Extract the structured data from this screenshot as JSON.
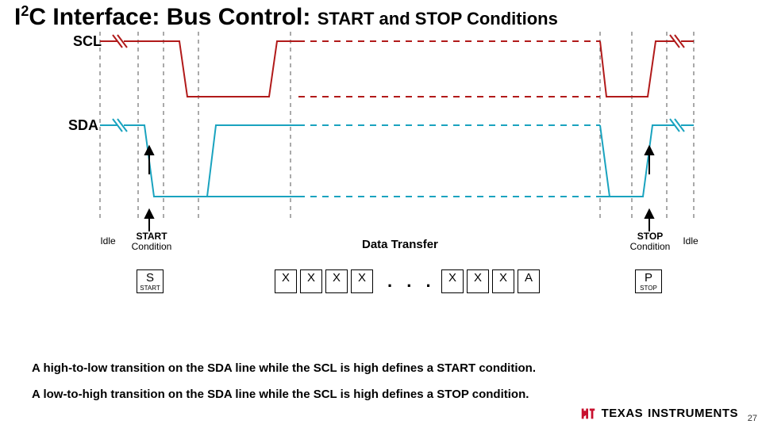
{
  "title": {
    "main_prefix": "I",
    "main_super": "2",
    "main_suffix": "C Interface: Bus Control:",
    "subtitle": "START and STOP Conditions"
  },
  "signals": {
    "scl": "SCL",
    "sda": "SDA"
  },
  "phases": {
    "idle_left": "Idle",
    "start_top": "START",
    "start_bottom": "Condition",
    "data": "Data Transfer",
    "stop_top": "STOP",
    "stop_bottom": "Condition",
    "idle_right": "Idle"
  },
  "boxes": {
    "start": {
      "big": "S",
      "small": "START"
    },
    "bits": [
      {
        "big": "X"
      },
      {
        "big": "X"
      },
      {
        "big": "X"
      },
      {
        "big": "X"
      },
      {
        "big": "X"
      },
      {
        "big": "X"
      },
      {
        "big": "X"
      },
      {
        "big": "A"
      }
    ],
    "ellipsis": ". . .",
    "stop": {
      "big": "P",
      "small": "STOP"
    }
  },
  "notes": {
    "line1": "A high-to-low transition on the SDA line while the SCL is high defines a START condition.",
    "line2": "A low-to-high transition on the SDA line while the SCL is high defines a STOP condition."
  },
  "footer": {
    "brand1": "TEXAS",
    "brand2": "INSTRUMENTS",
    "page": "27"
  },
  "colors": {
    "scl": "#b11a1a",
    "sda": "#1aa3bf",
    "guide": "#555"
  },
  "chart_data": {
    "type": "timing-diagram",
    "description": "I2C START and STOP conditions timing waveform",
    "signals": [
      {
        "name": "SCL",
        "hi": 1,
        "lo": 0,
        "events": [
          {
            "t": 0,
            "v": 1
          },
          {
            "t": 1,
            "v": 1
          },
          {
            "t": 1.05,
            "v": "break"
          },
          {
            "t": 1.4,
            "v": 1
          },
          {
            "t": 2.0,
            "v": 0
          },
          {
            "t": 3.2,
            "v": 0
          },
          {
            "t": 3.3,
            "v": 1
          },
          {
            "t": 4.0,
            "v": "break-dashed"
          },
          {
            "t": 6.6,
            "v": 1
          },
          {
            "t": 6.7,
            "v": 0
          },
          {
            "t": 7.5,
            "v": 0
          },
          {
            "t": 7.6,
            "v": 1
          },
          {
            "t": 8.2,
            "v": 1
          },
          {
            "t": 8.25,
            "v": "break"
          },
          {
            "t": 8.6,
            "v": 1
          }
        ]
      },
      {
        "name": "SDA",
        "hi": 1,
        "lo": 0,
        "events": [
          {
            "t": 0,
            "v": 1
          },
          {
            "t": 1,
            "v": 1
          },
          {
            "t": 1.05,
            "v": "break"
          },
          {
            "t": 1.2,
            "v": 1
          },
          {
            "t": 1.3,
            "v": 0
          },
          {
            "t": 2.2,
            "v": 0
          },
          {
            "t": 2.3,
            "v": "float"
          },
          {
            "t": 3.5,
            "v": "float"
          },
          {
            "t": 3.6,
            "v": "break-dashed"
          },
          {
            "t": 6.4,
            "v": "float"
          },
          {
            "t": 7.4,
            "v": 0
          },
          {
            "t": 7.9,
            "v": 0
          },
          {
            "t": 8.0,
            "v": 1
          },
          {
            "t": 8.2,
            "v": 1
          },
          {
            "t": 8.25,
            "v": "break"
          },
          {
            "t": 8.6,
            "v": 1
          }
        ]
      }
    ],
    "annotations": [
      {
        "region": "Idle",
        "from": 0,
        "to": 1
      },
      {
        "region": "START Condition",
        "from": 1.2,
        "to": 1.6,
        "rule": "SDA high→low while SCL high"
      },
      {
        "region": "Data Transfer",
        "from": 2.3,
        "to": 7.3
      },
      {
        "region": "STOP Condition",
        "from": 7.8,
        "to": 8.1,
        "rule": "SDA low→high while SCL high"
      },
      {
        "region": "Idle",
        "from": 8.3,
        "to": 8.6
      }
    ],
    "bit_boxes": [
      "S",
      "X",
      "X",
      "X",
      "X",
      "…",
      "X",
      "X",
      "X",
      "A",
      "P"
    ]
  }
}
